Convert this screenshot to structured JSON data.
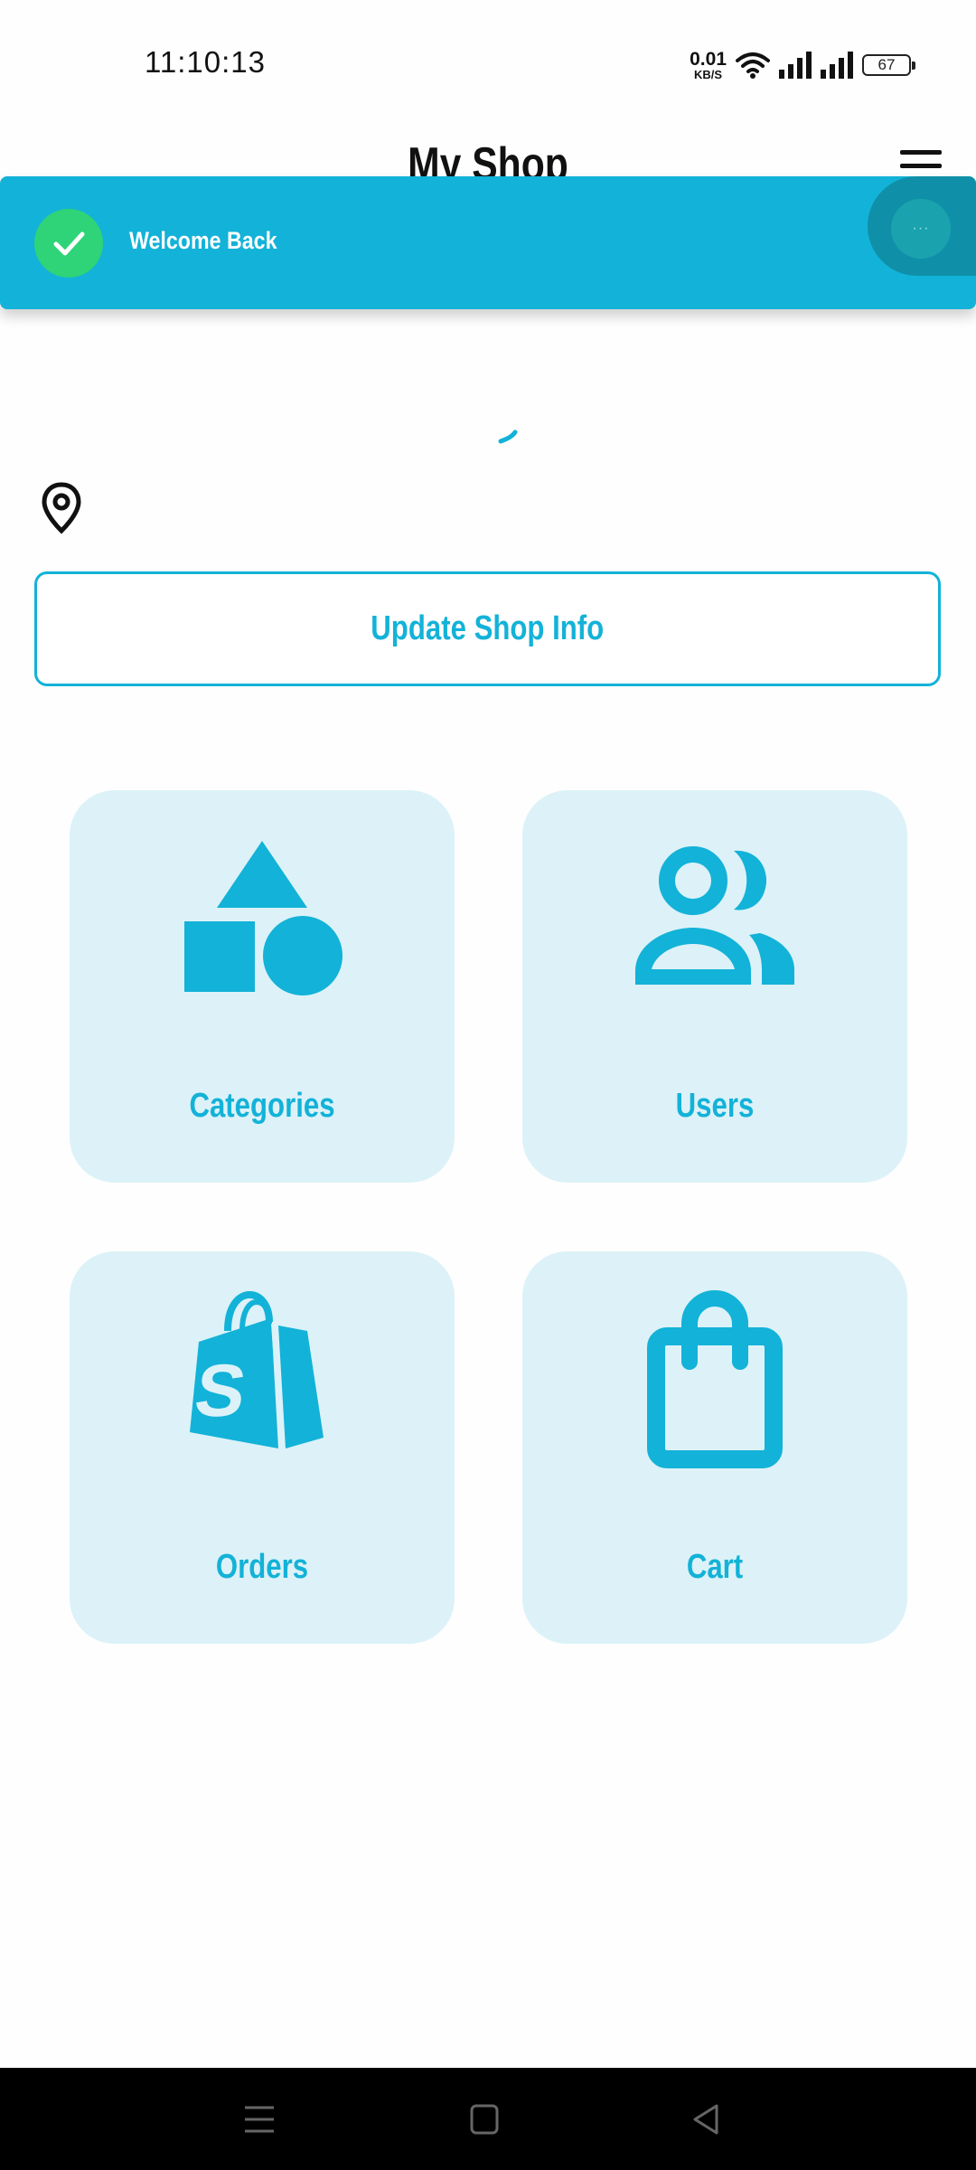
{
  "status_bar": {
    "time": "11:10:13",
    "net_speed_value": "0.01",
    "net_speed_unit": "KB/S",
    "battery": "67",
    "icons": [
      "wifi-icon",
      "signal-icon",
      "signal-icon",
      "battery-icon"
    ]
  },
  "app_bar": {
    "title": "My Shop",
    "menu_icon": "hamburger-menu-icon"
  },
  "toast": {
    "message": "Welcome Back",
    "icon": "check-icon",
    "more_label": "···"
  },
  "shop": {
    "location_icon": "location-pin-icon",
    "update_label": "Update Shop Info"
  },
  "tiles": [
    {
      "label": "Categories",
      "icon": "shapes-icon"
    },
    {
      "label": "Users",
      "icon": "users-icon"
    },
    {
      "label": "Orders",
      "icon": "shopify-bag-icon"
    },
    {
      "label": "Cart",
      "icon": "shopping-bag-icon"
    }
  ],
  "nav": {
    "items": [
      "recents-icon",
      "home-icon",
      "back-icon"
    ]
  },
  "colors": {
    "accent": "#13b2d8",
    "tile_bg": "#dcf2f8",
    "success": "#2ed477"
  }
}
